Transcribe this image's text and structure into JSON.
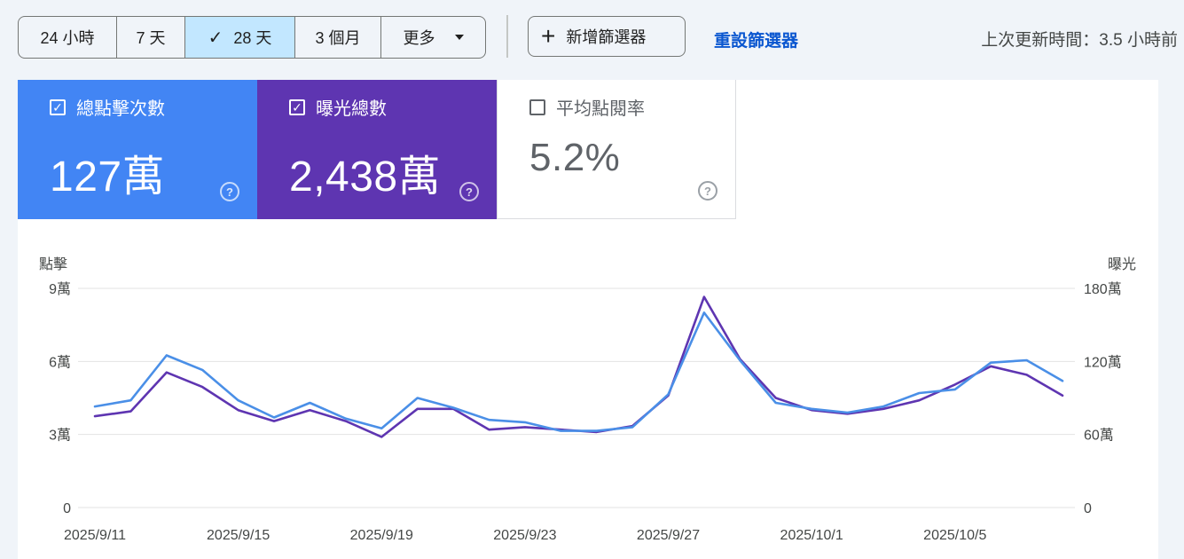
{
  "range_buttons": [
    {
      "label": "24 小時",
      "active": false
    },
    {
      "label": "7 天",
      "active": false
    },
    {
      "label": "28 天",
      "active": true,
      "icon": "check-icon"
    },
    {
      "label": "3 個月",
      "active": false
    },
    {
      "label": "更多",
      "active": false,
      "icon": "caret-down-icon"
    }
  ],
  "filters": {
    "add_label": "新增篩選器",
    "add_icon": "plus-icon",
    "reset_label": "重設篩選器"
  },
  "last_updated": "上次更新時間：3.5 小時前",
  "metrics": [
    {
      "label": "總點擊次數",
      "value": "127萬",
      "checked": true,
      "color": "#4285f4"
    },
    {
      "label": "曝光總數",
      "value": "2,438萬",
      "checked": true,
      "color": "#5e35b1"
    },
    {
      "label": "平均點閱率",
      "value": "5.2%",
      "checked": false,
      "color": "#ffffff"
    }
  ],
  "chart_data": {
    "type": "line",
    "left_axis_label": "點擊",
    "right_axis_label": "曝光",
    "left_ticks": [
      "9萬",
      "6萬",
      "3萬",
      "0"
    ],
    "right_ticks": [
      "180萬",
      "120萬",
      "60萬",
      "0"
    ],
    "left_ylim": [
      0,
      90000
    ],
    "right_ylim": [
      0,
      1800000
    ],
    "x_tick_labels": [
      "2025/9/11",
      "2025/9/15",
      "2025/9/19",
      "2025/9/23",
      "2025/9/27",
      "2025/10/1",
      "2025/10/5"
    ],
    "x": [
      "2025/9/11",
      "2025/9/12",
      "2025/9/13",
      "2025/9/14",
      "2025/9/15",
      "2025/9/16",
      "2025/9/17",
      "2025/9/18",
      "2025/9/19",
      "2025/9/20",
      "2025/9/21",
      "2025/9/22",
      "2025/9/23",
      "2025/9/24",
      "2025/9/25",
      "2025/9/26",
      "2025/9/27",
      "2025/9/28",
      "2025/9/29",
      "2025/9/30",
      "2025/10/1",
      "2025/10/2",
      "2025/10/3",
      "2025/10/4",
      "2025/10/5",
      "2025/10/6",
      "2025/10/7",
      "2025/10/8"
    ],
    "grid": true,
    "series": [
      {
        "axis": "left",
        "color": "#4a8fe7",
        "values": [
          41500,
          44000,
          62500,
          56500,
          44000,
          37000,
          43000,
          36500,
          32500,
          45000,
          41000,
          36000,
          35000,
          31500,
          31500,
          33000,
          46500,
          80000,
          60500,
          43000,
          40500,
          39000,
          41500,
          47000,
          48500,
          59500,
          60500,
          52000
        ]
      },
      {
        "axis": "right",
        "color": "#5e35b1",
        "values": [
          750000,
          790000,
          1110000,
          990000,
          800000,
          710000,
          800000,
          710000,
          580000,
          810000,
          810000,
          640000,
          660000,
          640000,
          620000,
          670000,
          920000,
          1730000,
          1220000,
          900000,
          800000,
          770000,
          810000,
          880000,
          1010000,
          1160000,
          1090000,
          920000
        ]
      }
    ]
  }
}
